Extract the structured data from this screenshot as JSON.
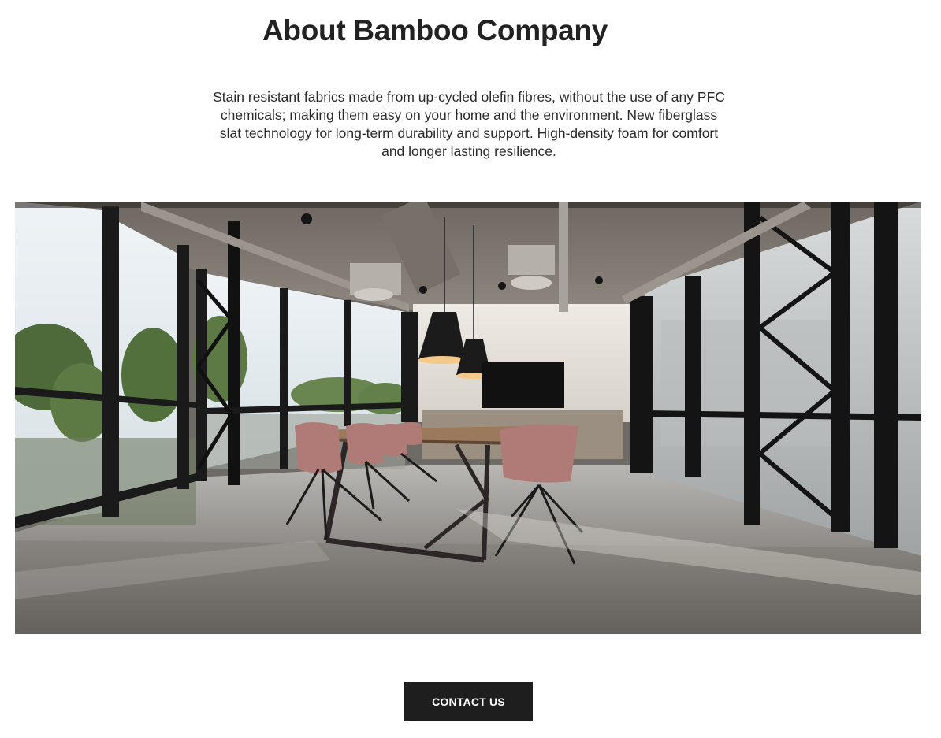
{
  "about": {
    "title": "About Bamboo Company",
    "description": "Stain resistant fabrics made from up-cycled olefin fibres, without the use of any PFC chemicals; making them easy on your home and the environment. New fiberglass slat technology for long-term durability and support. High-density foam for comfort and longer lasting resilience."
  },
  "hero_image": {
    "subject": "office-meeting-room"
  },
  "cta": {
    "label": "CONTACT US"
  }
}
